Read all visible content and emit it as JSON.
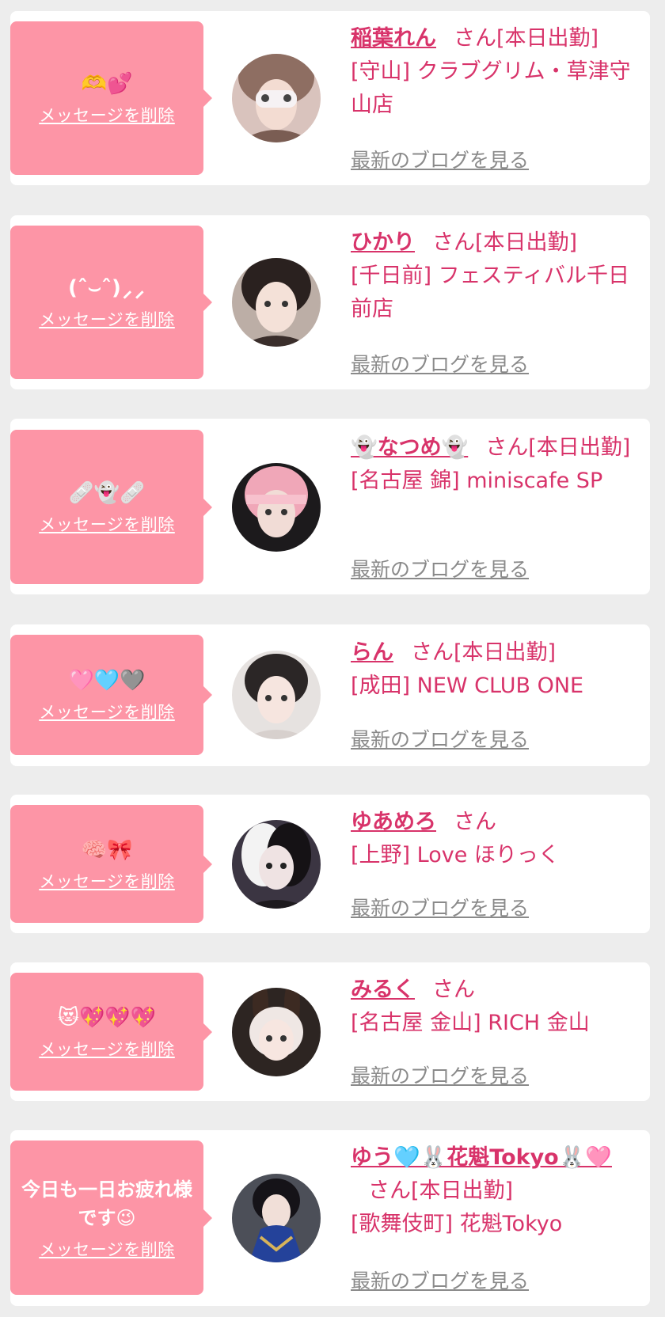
{
  "colors": {
    "background": "#ededed",
    "card": "#ffffff",
    "bubble": "#fd95a6",
    "accent": "#d8336a",
    "link_gray": "#8a8a8a"
  },
  "common": {
    "delete_label": "メッセージを削除",
    "blog_label": "最新のブログを見る",
    "honorific": "さん"
  },
  "items": [
    {
      "message": "🫶💕",
      "name": "稲葉れん",
      "status": "[本日出勤]",
      "shop": "[守山] クラブグリム・草津守山店",
      "avatar": "avatar-1"
    },
    {
      "message": "(ˆ⌣ˆ)⸝⸝",
      "name": "ひかり",
      "status": "[本日出勤]",
      "shop": "[千日前] フェスティバル千日前店",
      "avatar": "avatar-2"
    },
    {
      "message": "🩹👻🩹",
      "name": "👻なつめ👻",
      "status": "[本日出勤]",
      "shop": "[名古屋 錦] miniscafe SP",
      "avatar": "avatar-3"
    },
    {
      "message": "🩷🩵🩶",
      "name": "らん",
      "status": "[本日出勤]",
      "shop": "[成田] NEW CLUB ONE",
      "avatar": "avatar-4"
    },
    {
      "message": "🧠🎀",
      "name": "ゆあめろ",
      "status": "",
      "shop": "[上野] Love ほりっく",
      "avatar": "avatar-5"
    },
    {
      "message": "😻💖💖💖",
      "name": "みるく",
      "status": "",
      "shop": "[名古屋 金山] RICH 金山",
      "avatar": "avatar-6"
    },
    {
      "message": "今日も一日お疲れ様です😉",
      "name": "ゆう🩵🐰花魁Tokyo🐰🩷",
      "status": "[本日出勤]",
      "shop": "[歌舞伎町] 花魁Tokyo",
      "avatar": "avatar-7"
    }
  ]
}
